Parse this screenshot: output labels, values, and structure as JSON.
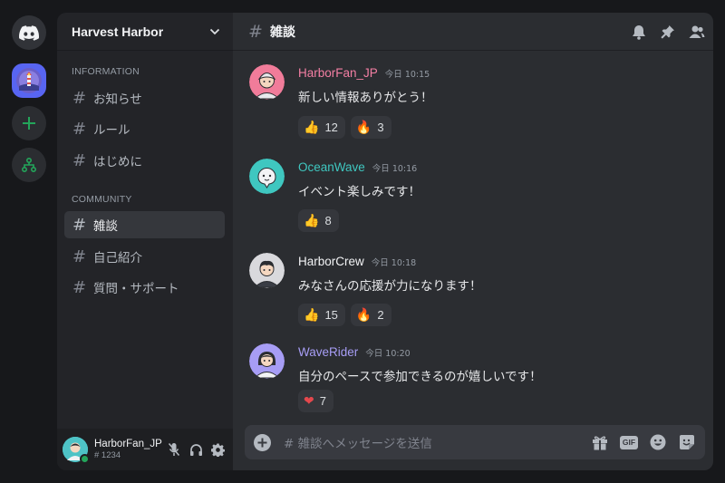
{
  "rail": {
    "items": [
      {
        "name": "discord-home"
      },
      {
        "name": "server-harvest-harbor"
      },
      {
        "name": "add-server"
      },
      {
        "name": "explore-servers"
      }
    ]
  },
  "server": {
    "name": "Harvest Harbor"
  },
  "categories": [
    {
      "label": "INFORMATION",
      "channels": [
        {
          "name": "お知らせ"
        },
        {
          "name": "ルール"
        },
        {
          "name": "はじめに"
        }
      ]
    },
    {
      "label": "COMMUNITY",
      "channels": [
        {
          "name": "雑談",
          "active": true
        },
        {
          "name": "自己紹介"
        },
        {
          "name": "質問・サポート"
        }
      ]
    }
  ],
  "channel_prefix": "#",
  "user": {
    "name": "HarborFan_JP",
    "tag": "# 1234",
    "status": "online"
  },
  "chat": {
    "title": "雑談",
    "messages": [
      {
        "user": "HarborFan_JP",
        "color": "#f47fa4",
        "time": "今日 10:15",
        "text": "新しい情報ありがとう！",
        "reactions": [
          {
            "emoji": "thumbs-up",
            "count": "12"
          },
          {
            "emoji": "fire",
            "count": "3"
          }
        ]
      },
      {
        "user": "OceanWave",
        "color": "#3fc7c0",
        "time": "今日 10:16",
        "text": "イベント楽しみです！",
        "reactions": [
          {
            "emoji": "thumbs-up",
            "count": "8"
          }
        ]
      },
      {
        "user": "HarborCrew",
        "color": "#f2f3f5",
        "time": "今日 10:18",
        "text": "みなさんの応援が力になります！",
        "reactions": [
          {
            "emoji": "thumbs-up",
            "count": "15"
          },
          {
            "emoji": "fire",
            "count": "2"
          }
        ]
      },
      {
        "user": "WaveRider",
        "color": "#a79df5",
        "time": "今日 10:20",
        "text": "自分のペースで参加できるのが嬉しいです！",
        "reactions": [
          {
            "emoji": "heart",
            "count": "7"
          }
        ]
      }
    ]
  },
  "composer": {
    "placeholder": "# 雑談へメッセージを送信",
    "gif_label": "GIF"
  },
  "colors": {
    "accent": "#5865f2",
    "online": "#23a55a",
    "add_green": "#23a55a"
  }
}
